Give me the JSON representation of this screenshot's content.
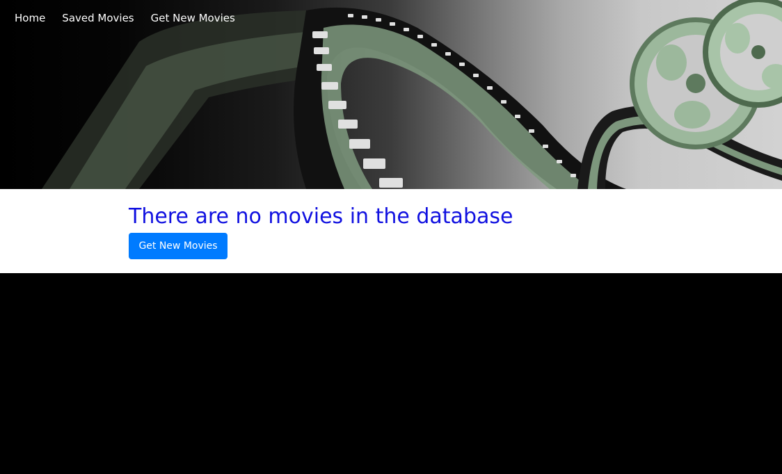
{
  "nav": {
    "items": [
      {
        "label": "Home"
      },
      {
        "label": "Saved Movies"
      },
      {
        "label": "Get New Movies"
      }
    ]
  },
  "main": {
    "heading": "There are no movies in the database",
    "button_label": "Get New Movies"
  },
  "colors": {
    "heading": "#1010e0",
    "button": "#007bff",
    "background": "#000000",
    "film_green": "#7f9a7f"
  },
  "icons": {
    "hero": "film-reel-strip-illustration"
  }
}
